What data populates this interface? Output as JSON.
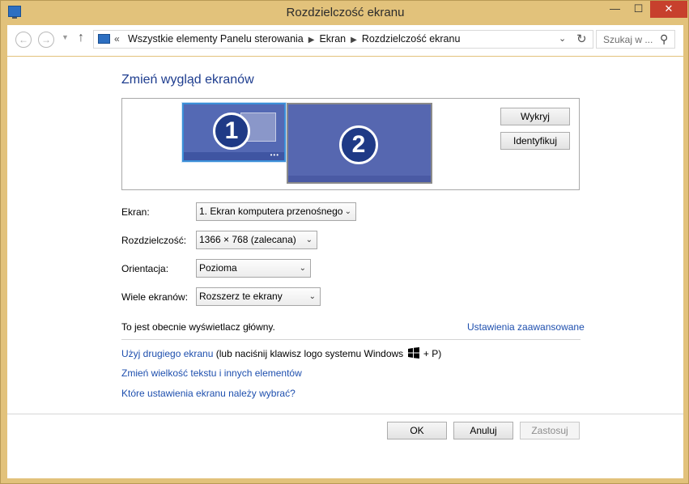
{
  "window": {
    "title": "Rozdzielczość ekranu"
  },
  "titlebar_buttons": {
    "minimize": "—",
    "maximize": "☐",
    "close": "✕"
  },
  "address": {
    "lead": "«",
    "crumbs": [
      "Wszystkie elementy Panelu sterowania",
      "Ekran",
      "Rozdzielczość ekranu"
    ],
    "search_placeholder": "Szukaj w ..."
  },
  "main": {
    "heading": "Zmień wygląd ekranów",
    "monitors": [
      "1",
      "2"
    ],
    "detect_label": "Wykryj",
    "identify_label": "Identyfikuj",
    "fields": {
      "display_label": "Ekran:",
      "display_value": "1. Ekran komputera przenośnego",
      "resolution_label": "Rozdzielczość:",
      "resolution_value": "1366 × 768 (zalecana)",
      "orientation_label": "Orientacja:",
      "orientation_value": "Pozioma",
      "multi_label": "Wiele ekranów:",
      "multi_value": "Rozszerz te ekrany"
    },
    "primary_text": "To jest obecnie wyświetlacz główny.",
    "advanced_link": "Ustawienia zaawansowane",
    "second_screen_link": "Użyj drugiego ekranu",
    "second_screen_hint_pre": "(lub naciśnij klawisz logo systemu Windows",
    "second_screen_hint_post": "+ P)",
    "text_size_link": "Zmień wielkość tekstu i innych elementów",
    "which_settings_link": "Które ustawienia ekranu należy wybrać?"
  },
  "footer": {
    "ok": "OK",
    "cancel": "Anuluj",
    "apply": "Zastosuj"
  },
  "colors": {
    "link": "#1e4fae",
    "heading": "#1e3d8f",
    "frame": "#e2c27b",
    "monitor": "#5469b4"
  }
}
